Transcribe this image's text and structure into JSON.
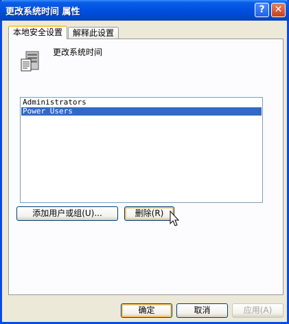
{
  "window": {
    "title": "更改系统时间 属性",
    "help_label": "?",
    "close_label": "✕"
  },
  "tabs": [
    {
      "label": "本地安全设置"
    },
    {
      "label": "解释此设置"
    }
  ],
  "policy": {
    "name": "更改系统时间",
    "icon": "policy-server-icon"
  },
  "list": {
    "items": [
      {
        "label": "Administrators",
        "selected": false
      },
      {
        "label": "Power Users",
        "selected": true
      }
    ]
  },
  "buttons": {
    "add_label": "添加用户或组(U)...",
    "remove_label": "删除(R)",
    "ok_label": "确定",
    "cancel_label": "取消",
    "apply_label": "应用(A)"
  },
  "colors": {
    "titlebar": "#0050e0",
    "selection": "#316ac5",
    "focus": "#f6c46a"
  }
}
